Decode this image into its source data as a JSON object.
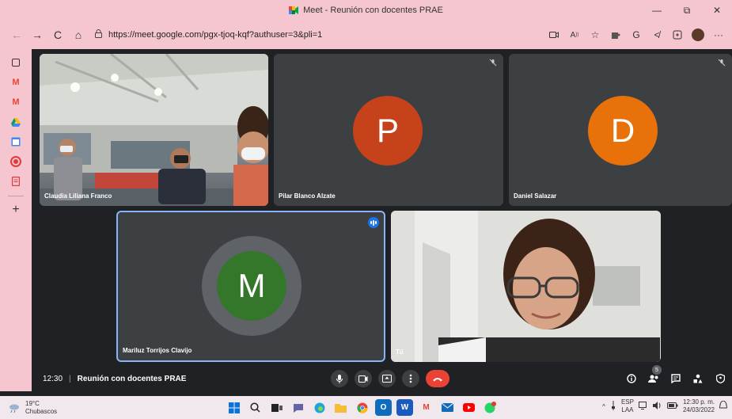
{
  "window": {
    "title": "Meet - Reunión con docentes PRAE",
    "minimize": "—",
    "maximize": "⧉",
    "close": "✕"
  },
  "browser": {
    "url": "https://meet.google.com/pgx-tjoq-kqf?authuser=3&pli=1",
    "back_icon": "←",
    "forward_icon": "→",
    "reload_icon": "C",
    "home_icon": "⌂",
    "lock_icon": "🔒",
    "more_icon": "···"
  },
  "sidebar": {
    "items": [
      "tab-icon",
      "gmail-icon",
      "gmail-icon-2",
      "drive-icon",
      "calendar-icon",
      "record-icon",
      "docs-icon"
    ],
    "add": "+"
  },
  "meet": {
    "participants": [
      {
        "name": "Claudia Liliana Franco"
      },
      {
        "name": "Pilar Blanco Alzate",
        "initial": "P",
        "color": "#c5421a"
      },
      {
        "name": "Daniel Salazar",
        "initial": "D",
        "color": "#e8710a"
      },
      {
        "name": "Mariluz Torrijos Clavijo",
        "initial": "M",
        "color": "#34772b"
      },
      {
        "name": "Tú"
      }
    ],
    "time": "12:30",
    "separator": "|",
    "meeting_title": "Reunión con docentes PRAE",
    "people_count": "5"
  },
  "taskbar": {
    "temperature": "19°C",
    "weather": "Chubascos",
    "lang_top": "ESP",
    "lang_bottom": "LAA",
    "time": "12:30 p. m.",
    "date": "24/03/2022"
  },
  "colors": {
    "meet_bg": "#202124",
    "tile_bg": "#3c4043",
    "accent": "#1a73e8",
    "end_call": "#ea4335",
    "chrome_pink": "#f5c6cf"
  }
}
